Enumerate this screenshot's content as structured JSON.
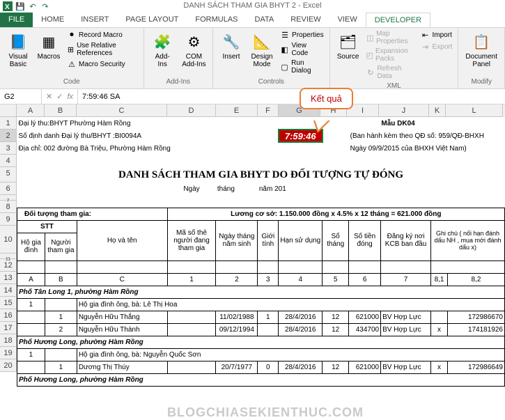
{
  "title": "DANH SÁCH THAM GIA BHYT 2 - Excel",
  "qat": {
    "excel_icon": "X"
  },
  "tabs": [
    "FILE",
    "HOME",
    "INSERT",
    "PAGE LAYOUT",
    "FORMULAS",
    "DATA",
    "REVIEW",
    "VIEW",
    "DEVELOPER"
  ],
  "active_tab": "DEVELOPER",
  "ribbon": {
    "code": {
      "visual_basic": "Visual\nBasic",
      "macros": "Macros",
      "record_macro": "Record Macro",
      "use_relative": "Use Relative References",
      "macro_security": "Macro Security",
      "label": "Code"
    },
    "addins": {
      "addins": "Add-Ins",
      "com_addins": "COM\nAdd-Ins",
      "label": "Add-Ins"
    },
    "controls": {
      "insert": "Insert",
      "design_mode": "Design\nMode",
      "properties": "Properties",
      "view_code": "View Code",
      "run_dialog": "Run Dialog",
      "label": "Controls"
    },
    "xml": {
      "source": "Source",
      "map_props": "Map Properties",
      "expansion": "Expansion Packs",
      "refresh": "Refresh Data",
      "import": "Import",
      "export": "Export",
      "label": "XML"
    },
    "modify": {
      "doc_panel": "Document\nPanel",
      "label": "Modify"
    }
  },
  "namebox": "G2",
  "formula": "7:59:46 SA",
  "callout": "Kết quả",
  "cols": [
    "A",
    "B",
    "C",
    "D",
    "E",
    "F",
    "G",
    "H",
    "I",
    "J",
    "K",
    "L"
  ],
  "rows_visible": [
    1,
    2,
    3,
    4,
    5,
    6,
    7,
    8,
    9,
    10,
    11,
    12,
    13,
    14,
    15,
    16,
    17,
    18,
    19,
    20
  ],
  "sheet": {
    "r1": "Đại lý thu:BHYT Phường Hàm Rồng",
    "r2": "Số định danh Đại lý thu/BHYT :BI0094A",
    "clock": "7:59:46",
    "mau": "Mẫu DK04",
    "ban_hanh": "(Ban hành kèm theo QĐ số: 959/QĐ-BHXH",
    "r3": "Địa chỉ: 002 đường Bà Triệu, Phường Hàm Rồng",
    "ngay_line": "Ngày 09/9/2015 của BHXH Việt Nam)",
    "title": "DANH SÁCH THAM GIA BHYT DO ĐỐI TƯỢNG TỰ ĐÓNG",
    "date_line_ngay": "Ngày",
    "date_line_thang": "tháng",
    "date_line_nam": "năm 201",
    "doi_tuong": "Đối tượng tham gia:",
    "luong": "Lương cơ sở: 1.150.000 đồng x 4.5% x 12 tháng = 621.000 đồng",
    "hdr_stt": "STT",
    "hdr_ho_gd": "Hộ gia đình",
    "hdr_nguoi": "Người tham gia",
    "hdr_hoten": "Họ và tên",
    "hdr_ma_so": "Mã số thẻ người đang tham gia",
    "hdr_ngaysinh": "Ngày tháng năm sinh",
    "hdr_gioi": "Giới tính",
    "hdr_han": "Hạn sử dụng",
    "hdr_sothang": "Số tháng",
    "hdr_sotien": "Số tiền đóng",
    "hdr_dangky": "Đăng ký nơi KCB ban đầu",
    "hdr_ghichu": "Ghi chú ( nối hạn đánh dấu NH , mua mới đánh dấu x)",
    "letters": {
      "a": "A",
      "b": "B",
      "c": "C",
      "d": "1",
      "e": "2",
      "f": "3",
      "g": "4",
      "h": "5",
      "i": "6",
      "j": "7",
      "k1": "8,1",
      "l": "8,2"
    },
    "pho1": "Phố Tân Long 1, phường Hàm Rồng",
    "pho2": "Phố Hương Long, phường Hàm Rồng",
    "pho3": "Phố Hương Long, phường Hàm Rồng",
    "r14_a": "1",
    "r14_c": "Hộ gia đình ông, bà: Lê Thị Hoa",
    "r15_b": "1",
    "r15_c": "Nguyễn Hữu Thắng",
    "r15_e": "11/02/1988",
    "r15_f": "1",
    "r15_g": "28/4/2016",
    "r15_h": "12",
    "r15_i": "621000",
    "r15_j": "BV Hợp Lực",
    "r15_l": "172986670",
    "r16_b": "2",
    "r16_c": "Nguyễn Hữu Thành",
    "r16_e": "09/12/1994",
    "r16_g": "28/4/2016",
    "r16_h": "12",
    "r16_i": "434700",
    "r16_j": "BV Hợp Lực",
    "r16_k": "x",
    "r16_l": "174181926",
    "r18_a": "1",
    "r18_c": "Hộ gia đình ông, bà: Nguyễn Quốc Sơn",
    "r19_b": "1",
    "r19_c": "Dương Thị Thúy",
    "r19_e": "20/7/1977",
    "r19_f": "0",
    "r19_g": "28/4/2016",
    "r19_h": "12",
    "r19_i": "621000",
    "r19_j": "BV Hợp Lực",
    "r19_k": "x",
    "r19_l": "172986649"
  },
  "watermark": "BLOGCHIASEKIENTHUC.COM"
}
